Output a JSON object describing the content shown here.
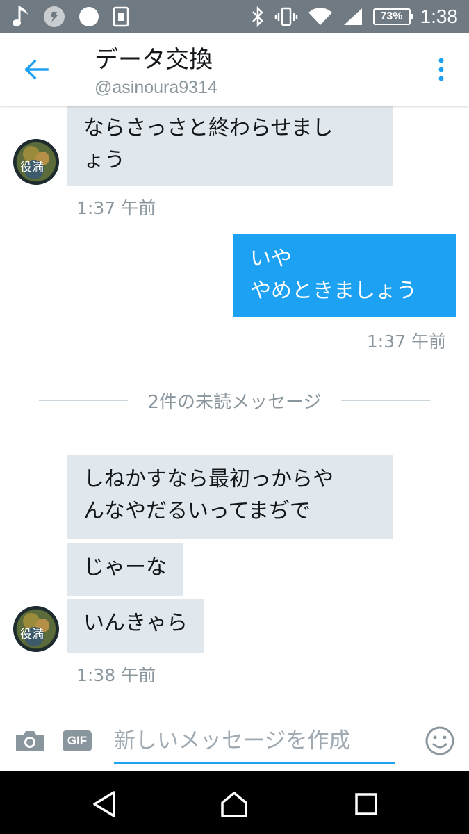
{
  "status_bar": {
    "battery": "73%",
    "time": "1:38",
    "icons": [
      "music-note-icon",
      "notification-icon",
      "circle-icon",
      "sim-icon",
      "bluetooth-icon",
      "vibrate-icon",
      "wifi-icon",
      "signal-icon",
      "battery-icon"
    ]
  },
  "header": {
    "title": "データ交換",
    "handle": "@asinoura9314"
  },
  "messages": {
    "m1_text": "ならさっさと終わらせまし\nょう",
    "m1_time": "1:37 午前",
    "m2_text": "いや\nやめときましょう",
    "m2_time": "1:37 午前",
    "unread_label": "2件の未読メッセージ",
    "m3_text": "しねかすなら最初っからや\nんなやだるいってまぢで",
    "m4_text": "じゃーな",
    "m5_text": "いんきゃら",
    "m5_time": "1:38 午前"
  },
  "avatar": {
    "text": "役満"
  },
  "composer": {
    "placeholder": "新しいメッセージを作成",
    "gif_label": "GIF"
  },
  "colors": {
    "accent": "#1da1f2",
    "bubble_in": "#e1e8ed",
    "muted": "#8a969e",
    "status_bar": "#6f7a82"
  }
}
